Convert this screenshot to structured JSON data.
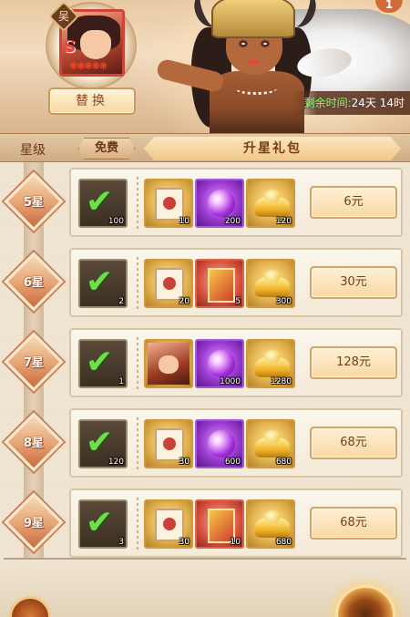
{
  "banner": {
    "faction": "吴",
    "swap_label": "替换",
    "corner_badge": "1",
    "timer_label": "剩余时间:",
    "timer_value": "24天 14时"
  },
  "tabs": {
    "star_level": "星级",
    "free": "免费",
    "star_pack": "升星礼包"
  },
  "rows": [
    {
      "star": "5星",
      "free_qty": "100",
      "items": [
        {
          "icon": "scroll-icon",
          "qty": "10"
        },
        {
          "icon": "purple-orb-icon",
          "qty": "200"
        },
        {
          "icon": "gold-ingot-icon",
          "qty": "120"
        }
      ],
      "price": "6元"
    },
    {
      "star": "6星",
      "free_qty": "2",
      "items": [
        {
          "icon": "scroll-icon",
          "qty": "20"
        },
        {
          "icon": "red-book-icon",
          "qty": "5"
        },
        {
          "icon": "gold-ingot-icon",
          "qty": "300"
        }
      ],
      "price": "30元"
    },
    {
      "star": "7星",
      "free_qty": "1",
      "items": [
        {
          "icon": "hero-card-icon",
          "qty": ""
        },
        {
          "icon": "purple-orb-icon",
          "qty": "1000"
        },
        {
          "icon": "gold-ingot-icon",
          "qty": "1280"
        }
      ],
      "price": "128元"
    },
    {
      "star": "8星",
      "free_qty": "120",
      "items": [
        {
          "icon": "scroll-icon",
          "qty": "30"
        },
        {
          "icon": "purple-orb-icon",
          "qty": "600"
        },
        {
          "icon": "gold-ingot-icon",
          "qty": "680"
        }
      ],
      "price": "68元"
    },
    {
      "star": "9星",
      "free_qty": "3",
      "items": [
        {
          "icon": "scroll-icon",
          "qty": "30"
        },
        {
          "icon": "red-book-icon",
          "qty": "10"
        },
        {
          "icon": "gold-ingot-icon",
          "qty": "680"
        }
      ],
      "price": "68元"
    }
  ]
}
